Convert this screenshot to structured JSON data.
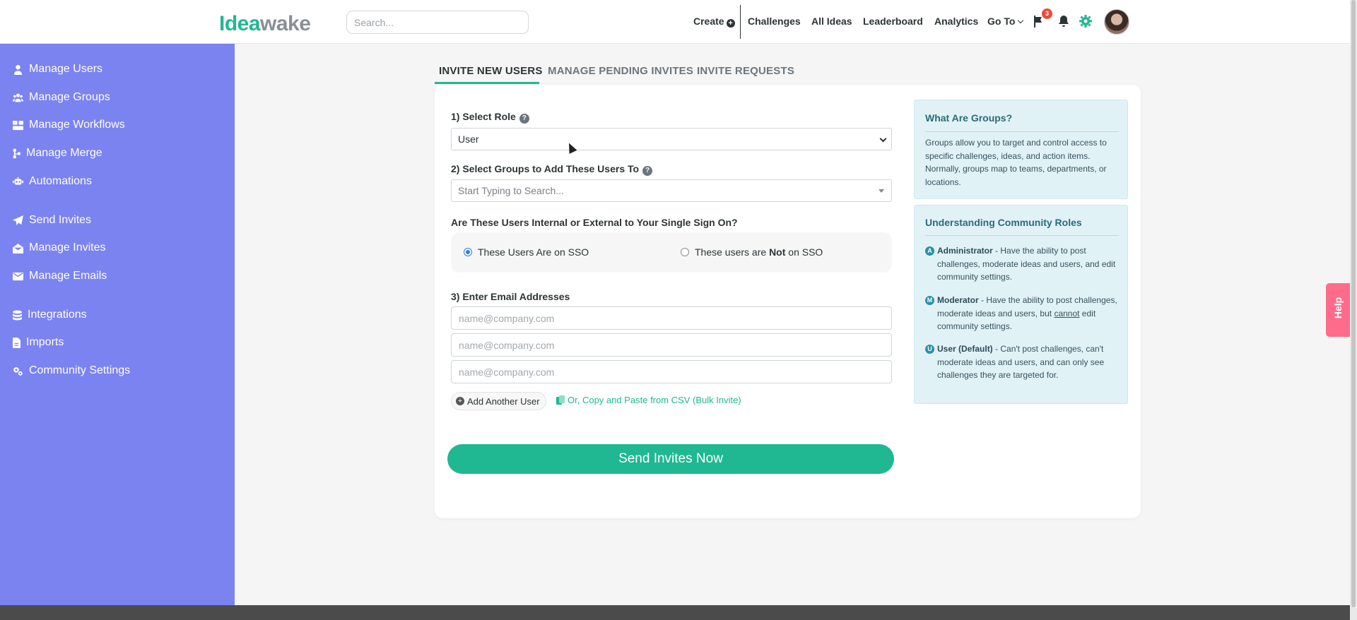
{
  "brand": {
    "logo_a": "Idea",
    "logo_b": "wake"
  },
  "search": {
    "placeholder": "Search..."
  },
  "topnav": {
    "create": "Create",
    "challenges": "Challenges",
    "all_ideas": "All Ideas",
    "leaderboard": "Leaderboard",
    "analytics": "Analytics",
    "goto": "Go To",
    "notification_count": "3"
  },
  "sidebar": {
    "items": [
      {
        "label": "Manage Users",
        "icon": "user-icon"
      },
      {
        "label": "Manage Groups",
        "icon": "users-icon"
      },
      {
        "label": "Manage Workflows",
        "icon": "workflow-icon"
      },
      {
        "label": "Manage Merge",
        "icon": "merge-icon"
      },
      {
        "label": "Automations",
        "icon": "robot-icon"
      },
      {
        "label": "Send Invites",
        "icon": "paper-plane-icon"
      },
      {
        "label": "Manage Invites",
        "icon": "envelope-open-icon"
      },
      {
        "label": "Manage Emails",
        "icon": "envelope-icon"
      },
      {
        "label": "Integrations",
        "icon": "database-icon"
      },
      {
        "label": "Imports",
        "icon": "file-import-icon"
      },
      {
        "label": "Community Settings",
        "icon": "gears-icon"
      }
    ]
  },
  "tabs": {
    "invite_new": "INVITE NEW USERS",
    "pending": "MANAGE PENDING INVITES",
    "requests": "INVITE REQUESTS"
  },
  "form": {
    "role_label": "1) Select Role",
    "role_value": "User",
    "groups_label": "2) Select Groups to Add These Users To",
    "groups_placeholder": "Start Typing to Search...",
    "sso_question": "Are These Users Internal or External to Your Single Sign On?",
    "sso_on": "These Users Are on SSO",
    "sso_off_a": "These users are ",
    "sso_off_b": "Not",
    "sso_off_c": " on SSO",
    "email_label": "3) Enter Email Addresses",
    "email_placeholder": "name@company.com",
    "add_user": "Add Another User",
    "csv_link": "Or, Copy and Paste from CSV (Bulk Invite)",
    "send_button": "Send Invites Now"
  },
  "groups_info": {
    "title": "What Are Groups?",
    "body": "Groups allow you to target and control access to specific challenges, ideas, and action items. Normally, groups map to teams, departments, or locations."
  },
  "roles_info": {
    "title": "Understanding Community Roles",
    "admin_name": "Administrator",
    "admin_desc": " - Have the ability to post challenges, moderate ideas and users, and edit community settings.",
    "mod_name": "Moderator",
    "mod_desc_a": " - Have the ability to post challenges, moderate ideas and users, but ",
    "mod_desc_b": "cannot",
    "mod_desc_c": " edit community settings.",
    "user_name": "User (Default)",
    "user_desc": " - Can't post challenges, can't moderate ideas and users, and can only see challenges they are targeted for.",
    "admin_letter": "A",
    "mod_letter": "M",
    "user_letter": "U"
  },
  "help": {
    "label": "Help"
  },
  "colors": {
    "accent": "#1fb892",
    "sidebar": "#7b83f0",
    "help": "#ff6b8b"
  }
}
